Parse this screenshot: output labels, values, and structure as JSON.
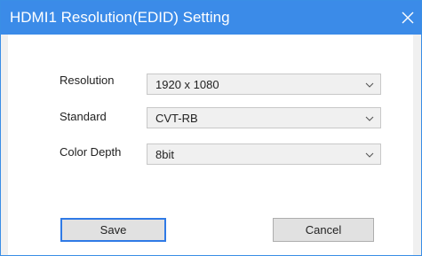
{
  "window": {
    "title": "HDMI1 Resolution(EDID) Setting",
    "close_icon": "close-icon"
  },
  "form": {
    "resolution": {
      "label": "Resolution",
      "value": "1920 x 1080"
    },
    "standard": {
      "label": "Standard",
      "value": "CVT-RB"
    },
    "color_depth": {
      "label": "Color Depth",
      "value": "8bit"
    }
  },
  "buttons": {
    "save": "Save",
    "cancel": "Cancel"
  },
  "colors": {
    "title_bar": "#3b8be8",
    "default_button_border": "#2f7ae6"
  }
}
